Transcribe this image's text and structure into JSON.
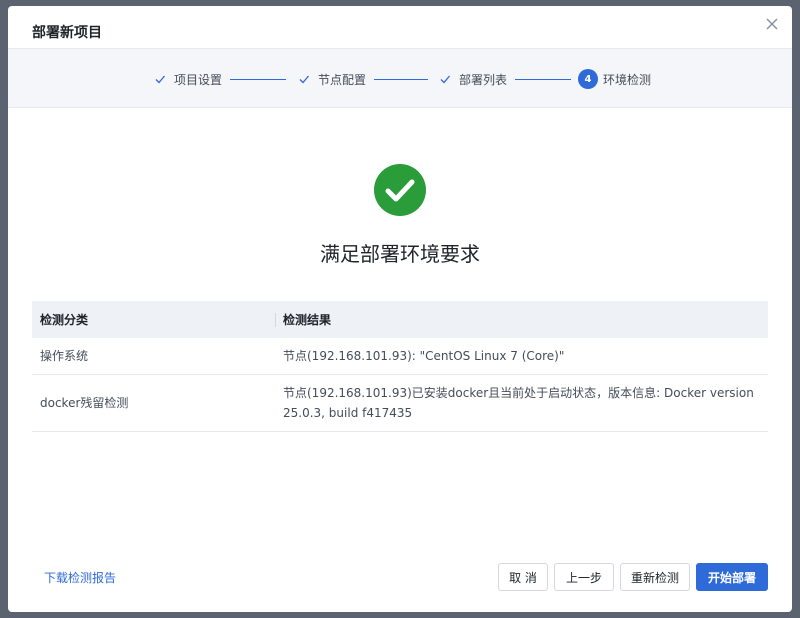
{
  "modal": {
    "title": "部署新项目"
  },
  "steps": [
    {
      "label": "项目设置",
      "status": "done"
    },
    {
      "label": "节点配置",
      "status": "done"
    },
    {
      "label": "部署列表",
      "status": "done"
    },
    {
      "label": "环境检测",
      "status": "active",
      "number": "4"
    }
  ],
  "result": {
    "title": "满足部署环境要求",
    "icon": "check-circle-icon",
    "color": "#2a9c3a"
  },
  "table": {
    "headers": [
      "检测分类",
      "检测结果"
    ],
    "rows": [
      {
        "category": "操作系统",
        "result": "节点(192.168.101.93): \"CentOS Linux 7 (Core)\""
      },
      {
        "category": "docker残留检测",
        "result": "节点(192.168.101.93)已安装docker且当前处于启动状态，版本信息: Docker version 25.0.3, build f417435"
      }
    ]
  },
  "footer": {
    "download_link": "下载检测报告",
    "cancel": "取 消",
    "prev": "上一步",
    "recheck": "重新检测",
    "deploy": "开始部署"
  },
  "colors": {
    "accent": "#2f6bd8",
    "success": "#2a9c3a"
  }
}
